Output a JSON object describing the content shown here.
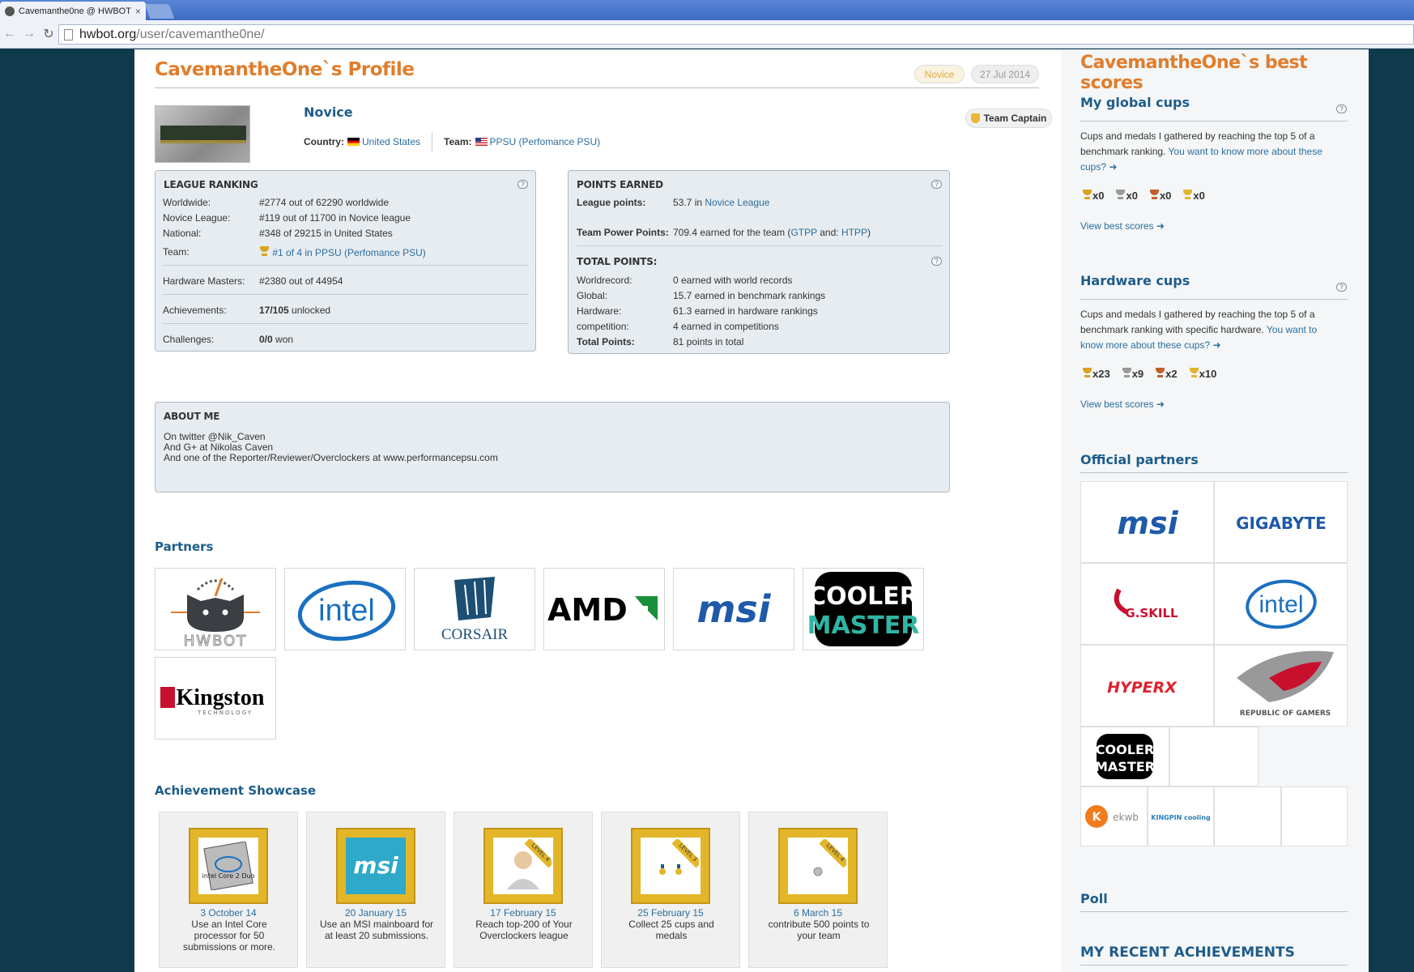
{
  "browser": {
    "tab_title": "Cavemanthe0ne @ HWBOT",
    "tab_close": "×",
    "url_host": "hwbot.org",
    "url_path": "/user/cavemanthe0ne/"
  },
  "profile": {
    "heading": "CavemantheOne`s Profile",
    "league_pill": "Novice",
    "date_pill": "27 Jul 2014",
    "rank": "Novice",
    "country_label": "Country:",
    "country": "United States",
    "team_label": "Team:",
    "team": "PPSU (Perfomance PSU)",
    "captain": "Team Captain"
  },
  "league": {
    "title": "LEAGUE RANKING",
    "rows": [
      {
        "k": "Worldwide:",
        "v": "#2774 out of 62290 worldwide"
      },
      {
        "k": "Novice League:",
        "v": "#119 out of 11700 in Novice league"
      },
      {
        "k": "National:",
        "v": "#348 of 29215 in United States"
      },
      {
        "k": "Team:",
        "v": "#1 of 4 in PPSU (Perfomance PSU)"
      },
      {
        "k": "Hardware Masters:",
        "v": "#2380 out of 44954"
      },
      {
        "k": "Achievements:",
        "v_bold": "17/105",
        "v": " unlocked"
      },
      {
        "k": "Challenges:",
        "v_bold": "0/0",
        "v": " won"
      }
    ]
  },
  "points": {
    "title": "POINTS EARNED",
    "league_k": "League points:",
    "league_v_pre": "53.7 in ",
    "league_v_link": "Novice League",
    "tpp_k": "Team Power Points:",
    "tpp_v_pre": "709.4 earned for the team (",
    "tpp_v_link1": "GTPP",
    "tpp_v_mid": " and: ",
    "tpp_v_link2": "HTPP",
    "tpp_v_post": ")",
    "total_title": "TOTAL POINTS:",
    "rows": [
      {
        "k": "Worldrecord:",
        "v": "0 earned with world records"
      },
      {
        "k": "Global:",
        "v": "15.7 earned in benchmark rankings"
      },
      {
        "k": "Hardware:",
        "v": "61.3 earned in hardware rankings"
      },
      {
        "k": "competition:",
        "v": "4 earned in competitions"
      },
      {
        "k": "Total Points:",
        "v": "81 points in total"
      }
    ]
  },
  "about": {
    "title": "ABOUT ME",
    "lines": [
      "On twitter @Nik_Caven",
      "And G+ at Nikolas Caven",
      "And one of the Reporter/Reviewer/Overclockers at www.performancepsu.com"
    ]
  },
  "partners": {
    "title": "Partners",
    "logos": [
      "HWBOT",
      "intel",
      "CORSAIR",
      "AMD",
      "msi",
      "COOLER MASTER",
      "Kingston",
      "TECHNOLOGY"
    ]
  },
  "achievements": {
    "title": "Achievement Showcase",
    "items": [
      {
        "date": "3 October 14",
        "desc": "Use an Intel Core processor for 50 submissions or more.",
        "badge": "intel Core 2 Duo"
      },
      {
        "date": "20 January 15",
        "desc": "Use an MSI mainboard for at least 20 submissions.",
        "badge": "msi"
      },
      {
        "date": "17 February 15",
        "desc": "Reach top-200 of Your Overclockers league",
        "badge": "LEVEL 4"
      },
      {
        "date": "25 February 15",
        "desc": "Collect 25 cups and medals",
        "badge": "LEVEL 3"
      },
      {
        "date": "6 March 15",
        "desc": "contribute 500 points to your team",
        "badge": "LEVEL 4"
      }
    ]
  },
  "sidebar": {
    "title": "CavemantheOne`s best scores",
    "global_title": "My global cups",
    "global_text": "Cups and medals I gathered by reaching the top 5 of a benchmark ranking.",
    "global_link": "You want to know more about these cups?",
    "global_cups": [
      "x0",
      "x0",
      "x0",
      "x0"
    ],
    "global_view": "View best scores",
    "hw_title": "Hardware cups",
    "hw_text": "Cups and medals I gathered by reaching the top 5 of a benchmark ranking with specific hardware.",
    "hw_link": "You want to know more about these cups?",
    "hw_cups": [
      "x23",
      "x9",
      "x2",
      "x10"
    ],
    "hw_view": "View best scores",
    "partners_title": "Official partners",
    "partner_logos": [
      "msi",
      "GIGABYTE",
      "G.SKILL",
      "intel",
      "HYPERX",
      "REPUBLIC OF GAMERS",
      "COOLER MASTER",
      "ekwb",
      "KINGPIN cooling"
    ],
    "poll_title": "Poll",
    "recent_title": "MY RECENT ACHIEVEMENTS"
  }
}
